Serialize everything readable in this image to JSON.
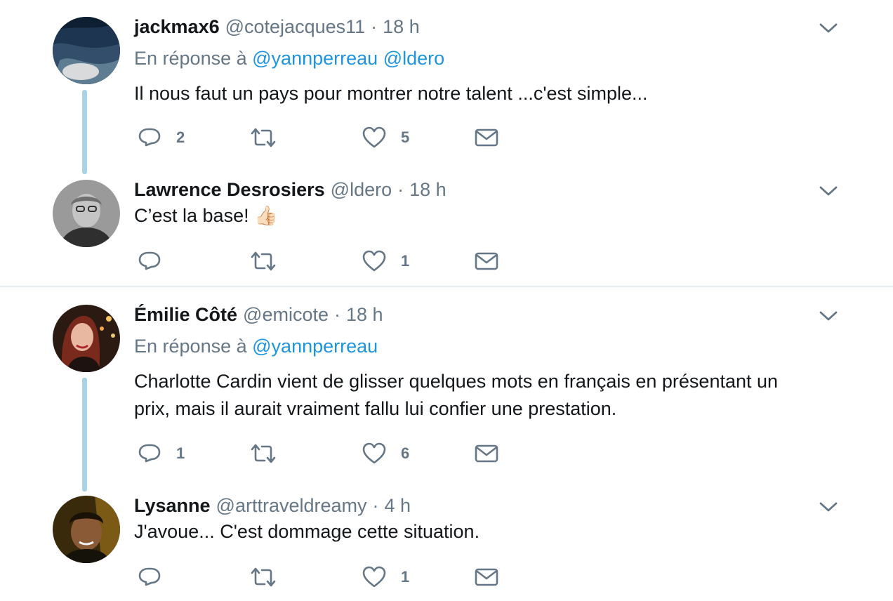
{
  "tweets": [
    {
      "name": "jackmax6",
      "handle": "@cotejacques11",
      "time": "18 h",
      "reply_prefix": "En réponse à",
      "reply_mentions": [
        "@yannperreau",
        "@ldero"
      ],
      "text": "Il nous faut un pays pour montrer notre talent ...c'est simple...",
      "reply_count": "2",
      "retweet_count": "",
      "like_count": "5"
    },
    {
      "name": "Lawrence Desrosiers",
      "handle": "@ldero",
      "time": "18 h",
      "text": "C’est la base!",
      "emoji": "👍🏻",
      "reply_count": "",
      "retweet_count": "",
      "like_count": "1"
    },
    {
      "name": "Émilie Côté",
      "handle": "@emicote",
      "time": "18 h",
      "reply_prefix": "En réponse à",
      "reply_mentions": [
        "@yannperreau"
      ],
      "text_line1": "Charlotte Cardin vient de glisser quelques mots en français en présentant un",
      "text_line2": "prix, mais il aurait vraiment fallu lui confier une prestation.",
      "reply_count": "1",
      "retweet_count": "",
      "like_count": "6"
    },
    {
      "name": "Lysanne",
      "handle": "@arttraveldreamy",
      "time": "4 h",
      "text": "J'avoue... C'est dommage cette situation.",
      "reply_count": "",
      "retweet_count": "",
      "like_count": "1"
    }
  ],
  "separator": "·",
  "icons": {
    "reply": "reply-icon",
    "retweet": "retweet-icon",
    "like": "heart-icon",
    "dm": "envelope-icon",
    "more": "chevron-down-icon"
  },
  "colors": {
    "text": "#14171a",
    "muted": "#657786",
    "link": "#1b95e0",
    "thread_line": "#a9d2e6",
    "divider": "#e6ecf0"
  }
}
